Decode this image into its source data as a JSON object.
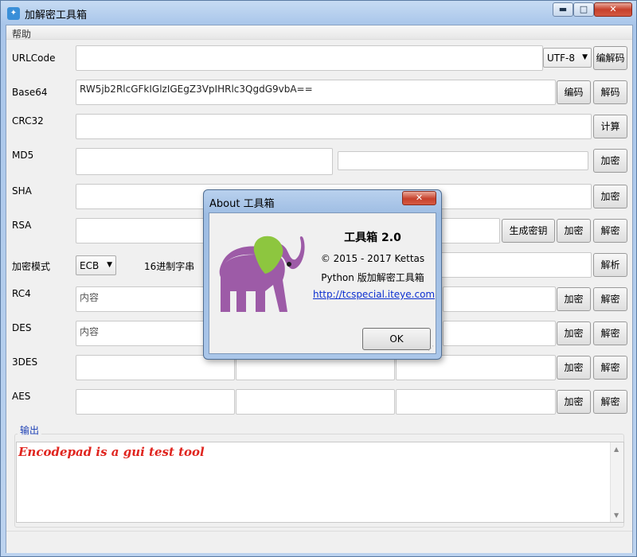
{
  "window": {
    "title": "加解密工具箱",
    "app_icon": "bird-icon",
    "min_label": "▬",
    "max_label": "□",
    "close_label": "✕"
  },
  "menu": [
    "帮助"
  ],
  "rows": {
    "urlcode": {
      "label": "URLCode",
      "value": "",
      "encoding": "UTF-8",
      "button": "编解码"
    },
    "base64": {
      "label": "Base64",
      "value": "RW5jb2RlcGFkIGlzIGEgZ3VpIHRlc3QgdG9vbA==",
      "encode": "编码",
      "decode": "解码"
    },
    "crc32": {
      "label": "CRC32",
      "value": "",
      "button": "计算"
    },
    "md5": {
      "label": "MD5",
      "input": "",
      "output": "",
      "button": "加密"
    },
    "sha": {
      "label": "SHA",
      "value": "",
      "button": "加密"
    },
    "rsa": {
      "label": "RSA",
      "value": "",
      "genkey": "生成密钥",
      "encrypt": "加密",
      "decrypt": "解密"
    },
    "mode": {
      "label": "加密模式",
      "mode_value": "ECB",
      "hex_label": "16进制字串",
      "value": "",
      "button": "解析"
    },
    "rc4": {
      "label": "RC4",
      "placeholder": "内容",
      "encrypt": "加密",
      "decrypt": "解密"
    },
    "des": {
      "label": "DES",
      "placeholder": "内容",
      "encrypt": "加密",
      "decrypt": "解密"
    },
    "tdes": {
      "label": "3DES",
      "encrypt": "加密",
      "decrypt": "解密"
    },
    "aes": {
      "label": "AES",
      "encrypt": "加密",
      "decrypt": "解密"
    }
  },
  "output": {
    "title": "输出",
    "text": "Encodepad is a gui test tool"
  },
  "about": {
    "title": "About 工具箱",
    "close_label": "✕",
    "app_name": "工具箱 2.0",
    "copyright": "© 2015 - 2017 Kettas",
    "description": "Python 版加解密工具箱",
    "link": "http://tcspecial.iteye.com",
    "ok_label": "OK",
    "logo_icon": "elephant-icon",
    "colors": {
      "elephant_body": "#9d5ba7",
      "elephant_ear": "#8dc63f"
    }
  },
  "colors": {
    "output_text": "#e0251f",
    "link": "#0b2fd0"
  }
}
